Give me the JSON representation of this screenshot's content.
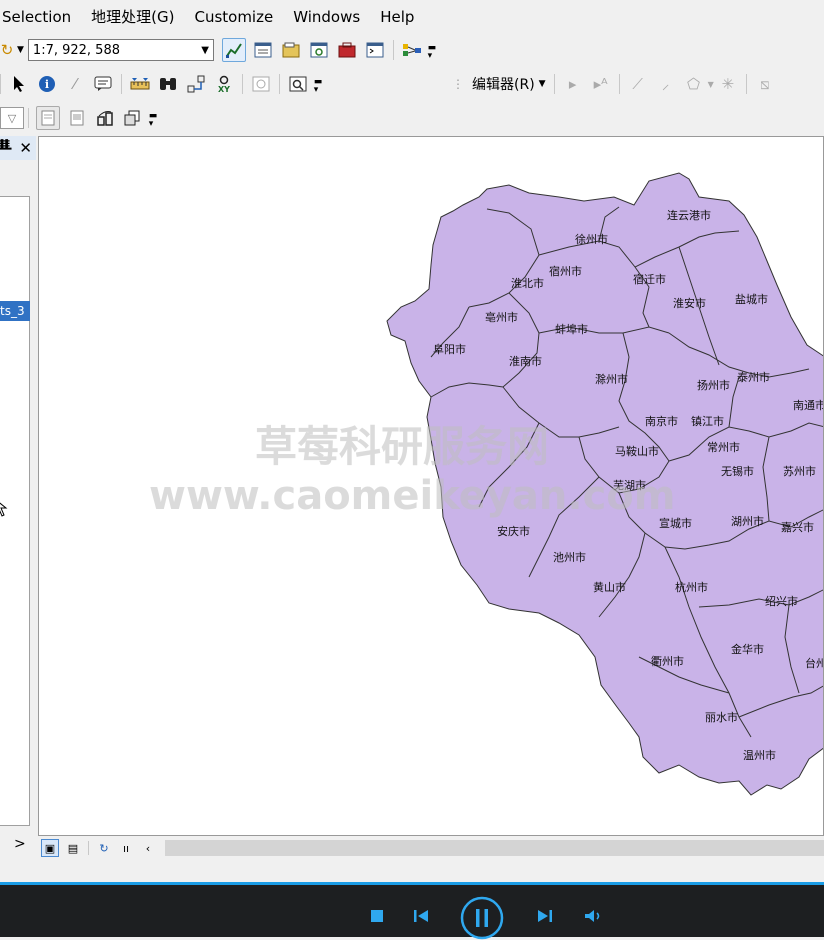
{
  "menubar": {
    "items": [
      "Selection",
      "地理处理(G)",
      "Customize",
      "Windows",
      "Help"
    ]
  },
  "toolbar_standard": {
    "scale_value": "1:7, 922, 588"
  },
  "toolbar_editor": {
    "label": "编辑器(R)"
  },
  "toc": {
    "selected_layer_label": "ts_3"
  },
  "map": {
    "fill_color": "#c9b3e8",
    "border_color": "#333333",
    "cities": [
      "连云港市",
      "徐州市",
      "宿州市",
      "淮北市",
      "宿迁市",
      "亳州市",
      "淮安市",
      "盐城市",
      "蚌埠市",
      "阜阳市",
      "淮南市",
      "滁州市",
      "扬州市",
      "泰州市",
      "南通市",
      "南京市",
      "镇江市",
      "常州市",
      "马鞍山市",
      "无锡市",
      "苏州市",
      "芜湖市",
      "宣城市",
      "湖州市",
      "嘉兴市",
      "安庆市",
      "池州市",
      "黄山市",
      "杭州市",
      "绍兴市",
      "衢州市",
      "金华市",
      "台州市",
      "丽水市",
      "温州市"
    ]
  },
  "watermark": {
    "line1": "草莓科研服务网",
    "line2": "www.caomeikeyan.com"
  },
  "player": {
    "accent_color": "#2fa8ef"
  }
}
